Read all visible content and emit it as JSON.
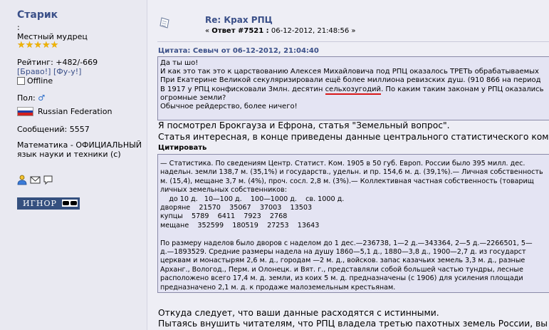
{
  "user": {
    "name": "Старик",
    "colon": ":",
    "rank": "Местный мудрец",
    "stars": [
      "★",
      "★",
      "★",
      "★",
      "★"
    ],
    "rating": "Рейтинг: +482/-669",
    "vote_up": "[Браво!]",
    "vote_down": "[Фу-у!]",
    "status": "Offline",
    "gender_label": "Пол: ",
    "gender_symbol": "♂",
    "country": "Russian Federation",
    "posts": "Сообщений: 5557",
    "about": "Математика - ОФИЦИАЛЬНЫЙ язык науки и техники (с)",
    "ignore_label": "ИГНОР",
    "colors": {
      "name": "#3a4f88",
      "stars": "#f0b400",
      "ignore_bg": "#35507f"
    }
  },
  "post": {
    "title": "Re: Крах РПЦ",
    "meta_prefix": "« ",
    "meta_answer": "Ответ #7521 :",
    "meta_date": " 06-12-2012, 21:48:56 »",
    "quote1": {
      "label": "Цитата: Севыч от 06-12-2012, 21:04:40",
      "lines": [
        "Да ты шо!",
        "И как это так это к царствованию Алексея Михайловича под РПЦ оказалось ТРЕТЬ обрабатываемых",
        "При Екатерине Великой секуляризировали ещё более миллиона ревизских душ. (910 866 на период",
        "В 1917 у РПЦ конфисковали 3млн. десятин ",
        " огромные земли?",
        "Обычное рейдерство, более ничего!"
      ],
      "underlined": "сельхозугодий",
      "line4_tail": ". По каким таким законам у РПЦ оказались"
    },
    "text1": "Я посмотрел Брокгауза и Ефрона, статья \"Земельный вопрос\".",
    "text2": "Статья интересная, в конце приведены данные центрального статистического комитета",
    "quote2": {
      "label": "Цитировать",
      "lines": [
        "— Статистика. По сведениям Центр. Статист. Ком. 1905 в 50 губ. Европ. России было 395 милл. дес.",
        "надельн. земли 138,7 м. (35,1%) и государств., удельн. и пр. 154,6 м. д. (39,1%).— Личная собственность",
        "м. (15,4), мещане 3,7 м. (4%), проч. сосл. 2,8 м. (3%).— Коллективная частная собственность (товарищ",
        "личных земельных собственников:",
        "    до 10 д.   10—100 д.    100—1000 д.    св. 1000 д.",
        "дворяне    21570    35067    37003    13503",
        "купцы    5789    6411    7923    2768",
        "мещане    352599    180519    27253    13643",
        "",
        "По размеру наделов было дворов с наделом до 1 дес.—236738, 1—2 д.—343364, 2—5 д.—2266501, 5—",
        "д.—1893529. Средние размеры надела на душу 1860—5,1 д., 1880—3,8 д., 1900—2,7 д. из государст",
        "церквам и монастырям 2,6 м. д., городам —2 м. д., войсков. запас казачьих земель 3,3 м. д., разные",
        "Арханг., Вологод., Перм. и Олонецк. и Вят. г., представляли собой большей частью тундры, лесные",
        "расположено всего 17,4 м. д. земли, из коих 5 м. д. предназначены (с 1906) для усиления площади",
        "предназначено 2,1 м. д. к продаже малоземельным крестьянам."
      ]
    },
    "text3": "Откуда следует, что ваши данные расходятся с истинными.",
    "text4": "Пытаясь внушить читателям, что РПЦ владела третью пахотных земель России, вы"
  }
}
